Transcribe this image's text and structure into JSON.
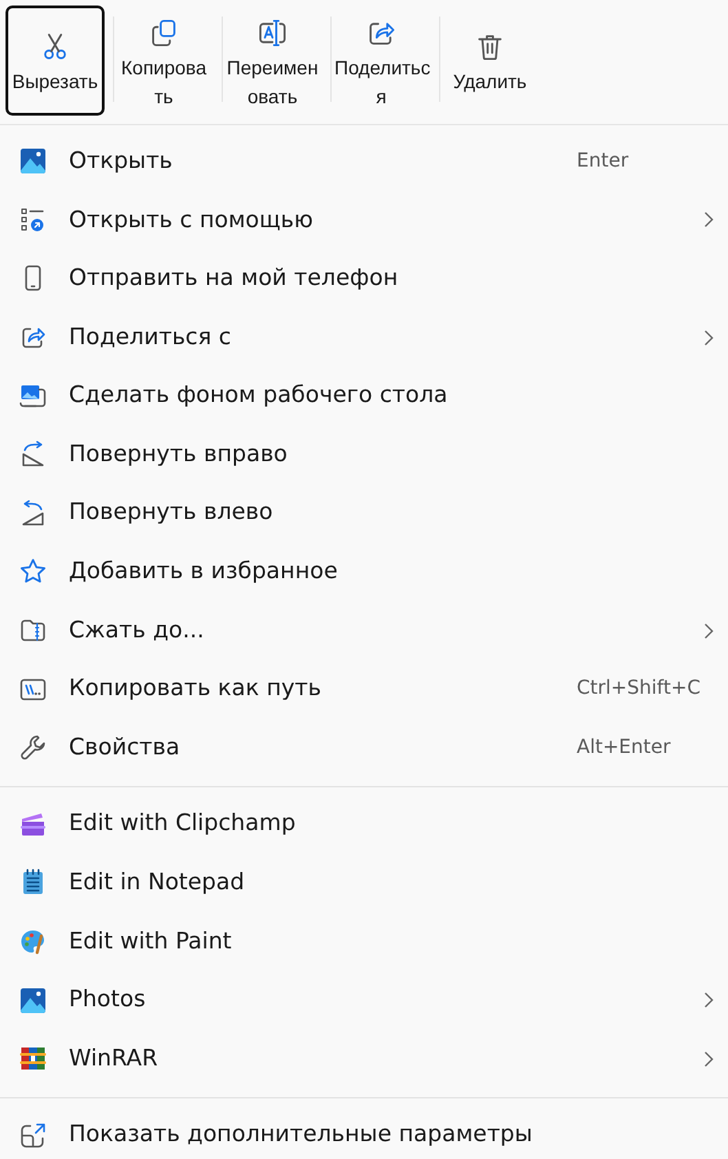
{
  "toolbar": [
    {
      "label_lines": [
        "Вырезать"
      ],
      "focused": true
    },
    {
      "label_lines": [
        "Копирова",
        "ть"
      ],
      "focused": false
    },
    {
      "label_lines": [
        "Переимен",
        "овать"
      ],
      "focused": false
    },
    {
      "label_lines": [
        "Поделитьс",
        "я"
      ],
      "focused": false
    },
    {
      "label_lines": [
        "Удалить"
      ],
      "focused": false
    }
  ],
  "sections": [
    {
      "items": [
        {
          "label": "Открыть",
          "shortcut": "Enter",
          "submenu": false
        },
        {
          "label": "Открыть с помощью",
          "submenu": true
        },
        {
          "label": "Отправить на мой телефон",
          "submenu": false
        },
        {
          "label": "Поделиться с",
          "submenu": true
        },
        {
          "label": "Сделать фоном рабочего стола",
          "submenu": false
        },
        {
          "label": "Повернуть вправо",
          "submenu": false
        },
        {
          "label": "Повернуть влево",
          "submenu": false
        },
        {
          "label": "Добавить в избранное",
          "submenu": false
        },
        {
          "label": "Сжать до...",
          "submenu": true
        },
        {
          "label": "Копировать как путь",
          "shortcut": "Ctrl+Shift+C",
          "submenu": false
        },
        {
          "label": "Свойства",
          "shortcut": "Alt+Enter",
          "submenu": false
        }
      ]
    },
    {
      "items": [
        {
          "label": "Edit with Clipchamp",
          "submenu": false
        },
        {
          "label": "Edit in Notepad",
          "submenu": false
        },
        {
          "label": "Edit with Paint",
          "submenu": false
        },
        {
          "label": "Photos",
          "submenu": true
        },
        {
          "label": "WinRAR",
          "submenu": true
        }
      ]
    },
    {
      "items": [
        {
          "label": "Показать дополнительные параметры",
          "submenu": false
        }
      ]
    }
  ]
}
